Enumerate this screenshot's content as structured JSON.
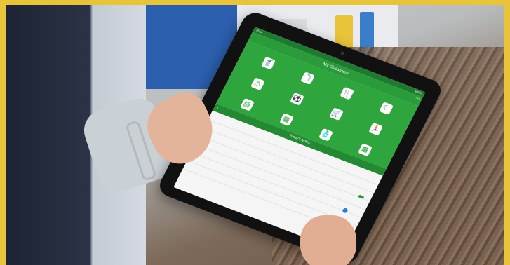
{
  "scene": {
    "frame_color": "#e8c43a",
    "accent": "#2fa53d",
    "description_tag": "tablet-app-photo"
  },
  "app": {
    "status_left": "iPad",
    "status_right": "100%",
    "title": "My Classroom",
    "header_button": "",
    "tiles": [
      {
        "icon": "drink-icon",
        "glyph": "🥤",
        "label": ""
      },
      {
        "icon": "toilet-paper-icon",
        "glyph": "🧻",
        "label": ""
      },
      {
        "icon": "utensils-icon",
        "glyph": "🍴",
        "label": ""
      },
      {
        "icon": "moon-icon",
        "glyph": "☾",
        "label": ""
      },
      {
        "icon": "warning-icon",
        "glyph": "⚠",
        "label": ""
      },
      {
        "icon": "ball-icon",
        "glyph": "⚽",
        "label": ""
      },
      {
        "icon": "cart-icon",
        "glyph": "🛒",
        "label": ""
      },
      {
        "icon": "running-icon",
        "glyph": "🏃",
        "label": ""
      },
      {
        "icon": "note-icon",
        "glyph": "▤",
        "label": ""
      },
      {
        "icon": "calendar-icon",
        "glyph": "▦",
        "label": ""
      },
      {
        "icon": "bottle-icon",
        "glyph": "🧴",
        "label": ""
      },
      {
        "icon": "grid-icon",
        "glyph": "▩",
        "label": ""
      }
    ],
    "back_label": "",
    "section_title": "Today's Notes",
    "list_items": [
      "",
      "",
      "",
      "",
      "",
      "",
      ""
    ],
    "add_button": ""
  }
}
